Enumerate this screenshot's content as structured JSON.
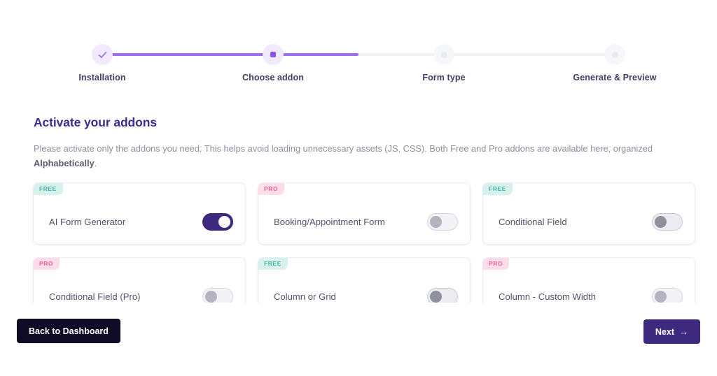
{
  "stepper": {
    "steps": [
      {
        "label": "Installation",
        "state": "done",
        "icon": "check-icon"
      },
      {
        "label": "Choose addon",
        "state": "active",
        "icon": "dot-icon"
      },
      {
        "label": "Form type",
        "state": "todo",
        "icon": "dot-icon"
      },
      {
        "label": "Generate & Preview",
        "state": "todo",
        "icon": "dot-icon"
      }
    ],
    "progress_percent": 50,
    "active_color": "#9b6ff0",
    "track_color": "#f1f1f5"
  },
  "content": {
    "heading": "Activate your addons",
    "description_prefix": "Please activate only the addons you need. This helps avoid loading unnecessary assets (JS, CSS). Both Free and Pro addons are available here, organized ",
    "description_emphasis": "Alphabetically",
    "description_suffix": "."
  },
  "addons": [
    {
      "name": "AI Form Generator",
      "badge": "FREE",
      "badge_type": "free",
      "enabled": true,
      "toggle_style": "on"
    },
    {
      "name": "Booking/Appointment Form",
      "badge": "PRO",
      "badge_type": "pro",
      "enabled": false,
      "toggle_style": "pale"
    },
    {
      "name": "Conditional Field",
      "badge": "FREE",
      "badge_type": "free",
      "enabled": false,
      "toggle_style": "solid"
    },
    {
      "name": "Conditional Field (Pro)",
      "badge": "PRO",
      "badge_type": "pro",
      "enabled": false,
      "toggle_style": "pale"
    },
    {
      "name": "Column or Grid",
      "badge": "FREE",
      "badge_type": "free",
      "enabled": false,
      "toggle_style": "solid"
    },
    {
      "name": "Column - Custom Width",
      "badge": "PRO",
      "badge_type": "pro",
      "enabled": false,
      "toggle_style": "pale"
    }
  ],
  "footer": {
    "back_label": "Back to Dashboard",
    "next_label": "Next",
    "next_arrow": "→",
    "back_color": "#100c28",
    "next_color": "#3d2a7e"
  },
  "colors": {
    "heading": "#3b2c96",
    "badge_free_bg": "#d7f2ec",
    "badge_free_text": "#45b6a2",
    "badge_pro_bg": "#fcdde9",
    "badge_pro_text": "#f4628f",
    "toggle_on": "#3d2a7e"
  }
}
